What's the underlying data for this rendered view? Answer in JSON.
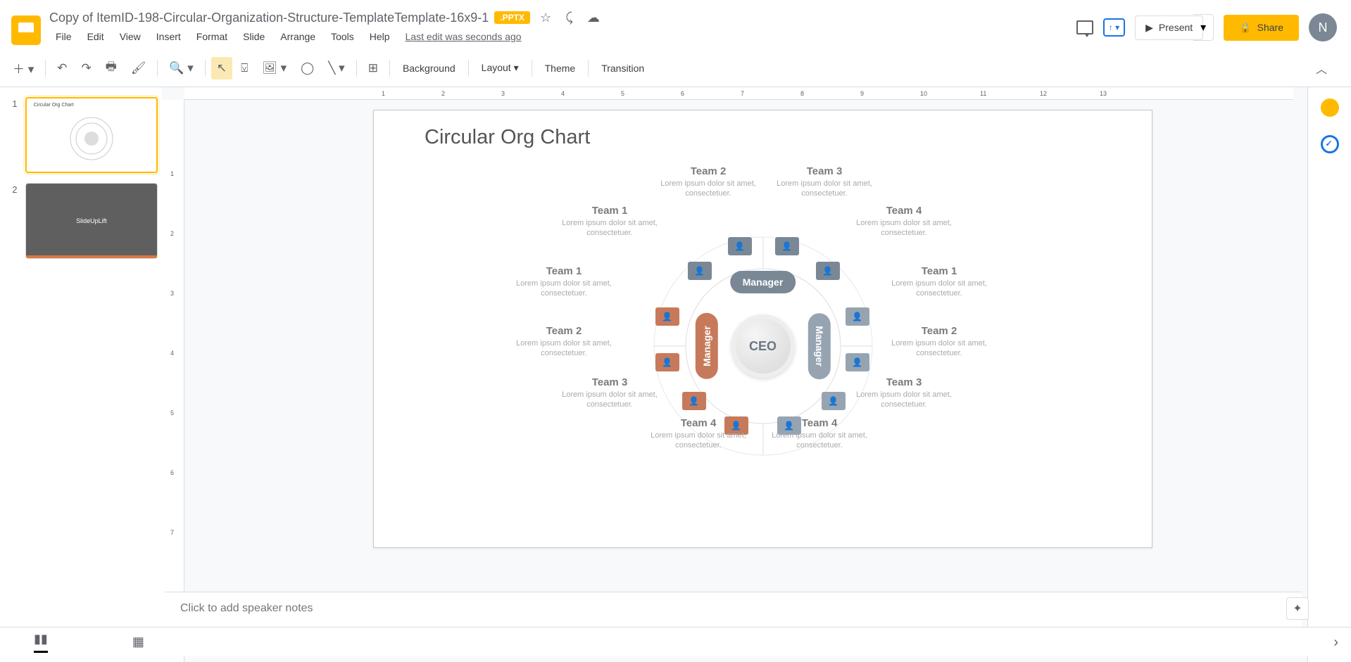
{
  "header": {
    "title": "Copy of ItemID-198-Circular-Organization-Structure-TemplateTemplate-16x9-1",
    "badge": ".PPTX",
    "last_edit": "Last edit was seconds ago",
    "present": "Present",
    "share": "Share",
    "avatar": "N"
  },
  "menus": [
    "File",
    "Edit",
    "View",
    "Insert",
    "Format",
    "Slide",
    "Arrange",
    "Tools",
    "Help"
  ],
  "toolbar": {
    "background": "Background",
    "layout": "Layout",
    "theme": "Theme",
    "transition": "Transition"
  },
  "thumbs": {
    "slide2": "SlideUpLift",
    "thumb1_title": "Circular Org Chart"
  },
  "slide": {
    "title": "Circular Org Chart",
    "ceo": "CEO",
    "manager": "Manager",
    "teams": [
      {
        "name": "Team 2",
        "desc": "Lorem ipsum dolor sit amet, consectetuer."
      },
      {
        "name": "Team 3",
        "desc": "Lorem ipsum dolor sit amet, consectetuer."
      },
      {
        "name": "Team 1",
        "desc": "Lorem ipsum dolor sit amet, consectetuer."
      },
      {
        "name": "Team 4",
        "desc": "Lorem ipsum dolor sit amet, consectetuer."
      },
      {
        "name": "Team 1",
        "desc": "Lorem ipsum dolor sit amet, consectetuer."
      },
      {
        "name": "Team 1",
        "desc": "Lorem ipsum dolor sit amet, consectetuer."
      },
      {
        "name": "Team 2",
        "desc": "Lorem ipsum dolor sit amet, consectetuer."
      },
      {
        "name": "Team 2",
        "desc": "Lorem ipsum dolor sit amet, consectetuer."
      },
      {
        "name": "Team 3",
        "desc": "Lorem ipsum dolor sit amet, consectetuer."
      },
      {
        "name": "Team 3",
        "desc": "Lorem ipsum dolor sit amet, consectetuer."
      },
      {
        "name": "Team 4",
        "desc": "Lorem ipsum dolor sit amet, consectetuer."
      },
      {
        "name": "Team 4",
        "desc": "Lorem ipsum dolor sit amet, consectetuer."
      }
    ]
  },
  "notes_placeholder": "Click to add speaker notes",
  "ruler_h": [
    1,
    2,
    3,
    4,
    5,
    6,
    7,
    8,
    9,
    10,
    11,
    12,
    13
  ],
  "ruler_v": [
    1,
    2,
    3,
    4,
    5,
    6,
    7
  ]
}
